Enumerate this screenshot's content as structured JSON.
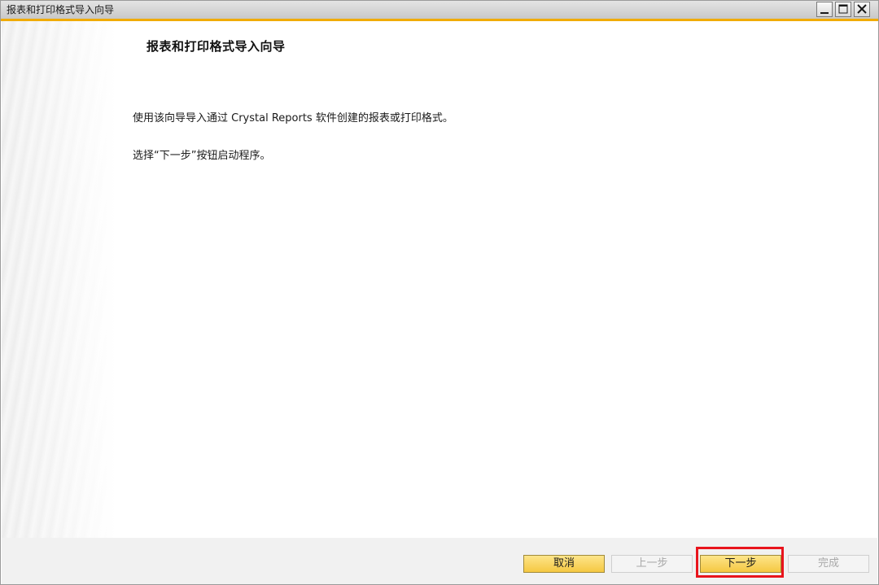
{
  "window": {
    "title": "报表和打印格式导入向导"
  },
  "title_bar_buttons": [
    {
      "name": "minimize",
      "icon": "minimize-icon"
    },
    {
      "name": "maximize",
      "icon": "maximize-icon"
    },
    {
      "name": "close",
      "icon": "close-icon"
    }
  ],
  "main": {
    "heading": "报表和打印格式导入向导",
    "paragraph1": "使用该向导导入通过 Crystal Reports 软件创建的报表或打印格式。",
    "paragraph2": "选择“下一步”按钮启动程序。"
  },
  "footer": {
    "cancel_label": "取消",
    "prev_label": "上一步",
    "next_label": "下一步",
    "finish_label": "完成"
  },
  "colors": {
    "accent_bar": "#f0ab00",
    "primary_button": "#f5c842",
    "highlight_box": "#e8141c"
  }
}
